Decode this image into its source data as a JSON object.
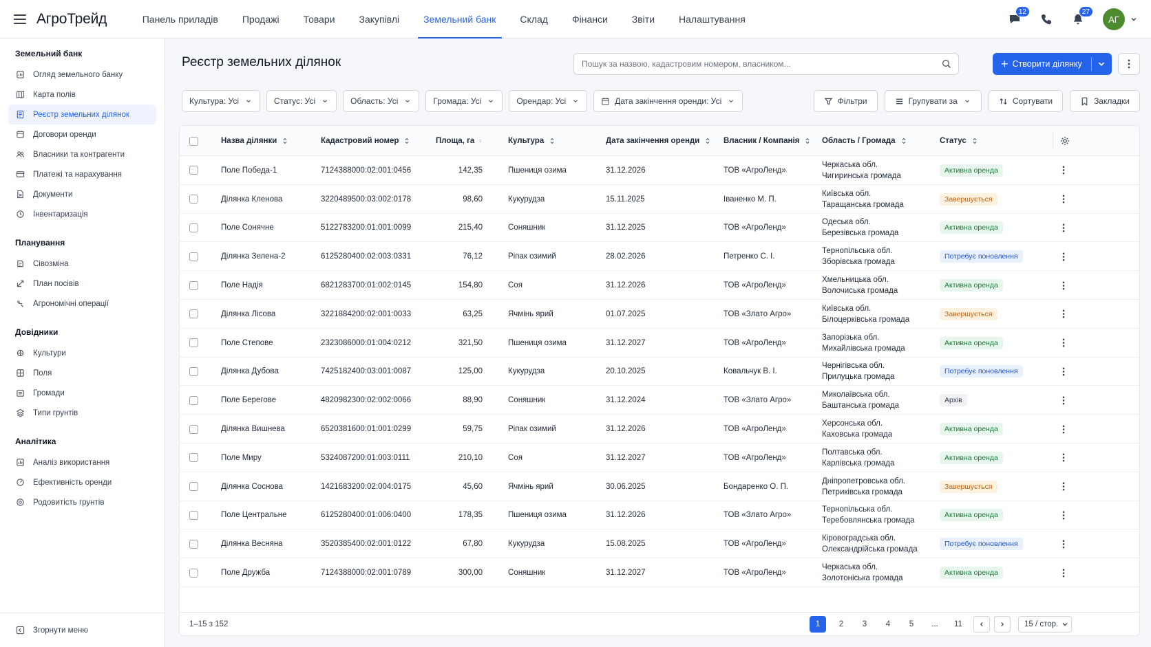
{
  "app": {
    "logo": "АгроТрейд"
  },
  "nav": [
    {
      "label": "Панель приладів",
      "active": false
    },
    {
      "label": "Продажі",
      "active": false
    },
    {
      "label": "Товари",
      "active": false
    },
    {
      "label": "Закупівлі",
      "active": false
    },
    {
      "label": "Земельний банк",
      "active": true
    },
    {
      "label": "Склад",
      "active": false
    },
    {
      "label": "Фінанси",
      "active": false
    },
    {
      "label": "Звіти",
      "active": false
    },
    {
      "label": "Налаштування",
      "active": false
    }
  ],
  "topbar": {
    "messages_badge": "12",
    "notifications_badge": "27",
    "avatar_initials": "АГ",
    "icons": [
      "chat-icon",
      "phone-icon",
      "bell-icon",
      "chevron-down-icon"
    ]
  },
  "sidebar": {
    "sections": [
      {
        "title": "Земельний банк",
        "items": [
          {
            "label": "Огляд земельного банку",
            "icon": "overview-icon",
            "active": false
          },
          {
            "label": "Карта полів",
            "icon": "map-icon",
            "active": false
          },
          {
            "label": "Реєстр земельних ділянок",
            "icon": "register-icon",
            "active": true
          },
          {
            "label": "Договори оренди",
            "icon": "contract-icon",
            "active": false
          },
          {
            "label": "Власники та контрагенти",
            "icon": "users-icon",
            "active": false
          },
          {
            "label": "Платежі та нарахування",
            "icon": "payments-icon",
            "active": false
          },
          {
            "label": "Документи",
            "icon": "document-icon",
            "active": false
          },
          {
            "label": "Інвентаризація",
            "icon": "inventory-icon",
            "active": false
          }
        ]
      },
      {
        "title": "Планування",
        "items": [
          {
            "label": "Сівозміна",
            "icon": "rotation-icon",
            "active": false
          },
          {
            "label": "План посівів",
            "icon": "plan-icon",
            "active": false
          },
          {
            "label": "Агрономічні операції",
            "icon": "tractor-icon",
            "active": false
          }
        ]
      },
      {
        "title": "Довідники",
        "items": [
          {
            "label": "Культури",
            "icon": "crop-icon",
            "active": false
          },
          {
            "label": "Поля",
            "icon": "field-icon",
            "active": false
          },
          {
            "label": "Громади",
            "icon": "community-icon",
            "active": false
          },
          {
            "label": "Типи грунтів",
            "icon": "soil-icon",
            "active": false
          }
        ]
      },
      {
        "title": "Аналітика",
        "items": [
          {
            "label": "Аналіз використання",
            "icon": "analytics-icon",
            "active": false
          },
          {
            "label": "Ефективність оренди",
            "icon": "efficiency-icon",
            "active": false
          },
          {
            "label": "Родовитість грунтів",
            "icon": "fertility-icon",
            "active": false
          }
        ]
      }
    ],
    "collapse_label": "Згорнути меню"
  },
  "page": {
    "title": "Реєстр земельних ділянок",
    "search_placeholder": "Пошук за назвою, кадастровим номером, власником...",
    "create_label": "Створити ділянку"
  },
  "filters": [
    "Культура: Усі",
    "Статус: Усі",
    "Область: Усі",
    "Громада: Усі",
    "Орендар: Усі",
    "Дата закінчення оренди: Усі"
  ],
  "actions": [
    {
      "label": "Фільтри",
      "icon": "filter-icon"
    },
    {
      "label": "Групувати за",
      "icon": "group-icon",
      "dropdown": true
    },
    {
      "label": "Сортувати",
      "icon": "sort-icon"
    },
    {
      "label": "Закладки",
      "icon": "bookmark-icon"
    }
  ],
  "table": {
    "columns": [
      "Назва ділянки",
      "Кадастровий номер",
      "Площа, га",
      "Культура",
      "Дата закінчення оренди",
      "Власник / Компанія",
      "Область / Громада",
      "Статус"
    ],
    "rows": [
      {
        "name": "Поле Победа-1",
        "cadastral": "7124388000:02:001:0456",
        "area": "142,35",
        "crop": "Пшениця озима",
        "date": "31.12.2026",
        "owner": "ТОВ «АгроЛенд»",
        "oblast": "Черкаська обл.",
        "hromada": "Чигиринська громада",
        "status": "Активна оренда",
        "status_type": "active"
      },
      {
        "name": "Ділянка Кленова",
        "cadastral": "3220489500:03:002:0178",
        "area": "98,60",
        "crop": "Кукурудза",
        "date": "15.11.2025",
        "owner": "Іваненко М. П.",
        "oblast": "Київська обл.",
        "hromada": "Таращанська громада",
        "status": "Завершується",
        "status_type": "ending"
      },
      {
        "name": "Поле Сонячне",
        "cadastral": "5122783200:01:001:0099",
        "area": "215,40",
        "crop": "Соняшник",
        "date": "31.12.2025",
        "owner": "ТОВ «АгроЛенд»",
        "oblast": "Одеська обл.",
        "hromada": "Березівська громада",
        "status": "Активна оренда",
        "status_type": "active"
      },
      {
        "name": "Ділянка Зелена-2",
        "cadastral": "6125280400:02:003:0331",
        "area": "76,12",
        "crop": "Ріпак озимий",
        "date": "28.02.2026",
        "owner": "Петренко С. І.",
        "oblast": "Тернопільська обл.",
        "hromada": "Зборівська громада",
        "status": "Потребує поновлення",
        "status_type": "renew"
      },
      {
        "name": "Поле Надія",
        "cadastral": "6821283700:01:002:0145",
        "area": "154,80",
        "crop": "Соя",
        "date": "31.12.2026",
        "owner": "ТОВ «АгроЛенд»",
        "oblast": "Хмельницька обл.",
        "hromada": "Волочиська громада",
        "status": "Активна оренда",
        "status_type": "active"
      },
      {
        "name": "Ділянка Лісова",
        "cadastral": "3221884200:02:001:0033",
        "area": "63,25",
        "crop": "Ячмінь ярий",
        "date": "01.07.2025",
        "owner": "ТОВ «Злато Агро»",
        "oblast": "Київська обл.",
        "hromada": "Білоцерківська громада",
        "status": "Завершується",
        "status_type": "ending"
      },
      {
        "name": "Поле Степове",
        "cadastral": "2323086000:01:004:0212",
        "area": "321,50",
        "crop": "Пшениця озима",
        "date": "31.12.2027",
        "owner": "ТОВ «АгроЛенд»",
        "oblast": "Запорізька обл.",
        "hromada": "Михайлівська громада",
        "status": "Активна оренда",
        "status_type": "active"
      },
      {
        "name": "Ділянка Дубова",
        "cadastral": "7425182400:03:001:0087",
        "area": "125,00",
        "crop": "Кукурудза",
        "date": "20.10.2025",
        "owner": "Ковальчук В. І.",
        "oblast": "Чернігівська обл.",
        "hromada": "Прилуцька громада",
        "status": "Потребує поновлення",
        "status_type": "renew"
      },
      {
        "name": "Поле Берегове",
        "cadastral": "4820982300:02:002:0066",
        "area": "88,90",
        "crop": "Соняшник",
        "date": "31.12.2024",
        "owner": "ТОВ «Злато Агро»",
        "oblast": "Миколаївська обл.",
        "hromada": "Баштанська громада",
        "status": "Архів",
        "status_type": "archive"
      },
      {
        "name": "Ділянка Вишнева",
        "cadastral": "6520381600:01:001:0299",
        "area": "59,75",
        "crop": "Ріпак озимий",
        "date": "31.12.2026",
        "owner": "ТОВ «АгроЛенд»",
        "oblast": "Херсонська обл.",
        "hromada": "Каховська громада",
        "status": "Активна оренда",
        "status_type": "active"
      },
      {
        "name": "Поле Миру",
        "cadastral": "5324087200:01:003:0111",
        "area": "210,10",
        "crop": "Соя",
        "date": "31.12.2027",
        "owner": "ТОВ «АгроЛенд»",
        "oblast": "Полтавська обл.",
        "hromada": "Карлівська громада",
        "status": "Активна оренда",
        "status_type": "active"
      },
      {
        "name": "Ділянка Соснова",
        "cadastral": "1421683200:02:004:0175",
        "area": "45,60",
        "crop": "Ячмінь ярий",
        "date": "30.06.2025",
        "owner": "Бондаренко О. П.",
        "oblast": "Дніпропетровська обл.",
        "hromada": "Петриківська громада",
        "status": "Завершується",
        "status_type": "ending"
      },
      {
        "name": "Поле Центральне",
        "cadastral": "6125280400:01:006:0400",
        "area": "178,35",
        "crop": "Пшениця озима",
        "date": "31.12.2026",
        "owner": "ТОВ «Злато Агро»",
        "oblast": "Тернопільська обл.",
        "hromada": "Теребовлянська громада",
        "status": "Активна оренда",
        "status_type": "active"
      },
      {
        "name": "Ділянка Весняна",
        "cadastral": "3520385400:02:001:0122",
        "area": "67,80",
        "crop": "Кукурудза",
        "date": "15.08.2025",
        "owner": "ТОВ «АгроЛенд»",
        "oblast": "Кіровоградська обл.",
        "hromada": "Олександрійська громада",
        "status": "Потребує поновлення",
        "status_type": "renew"
      },
      {
        "name": "Поле Дружба",
        "cadastral": "7124388000:02:001:0789",
        "area": "300,00",
        "crop": "Соняшник",
        "date": "31.12.2027",
        "owner": "ТОВ «АгроЛенд»",
        "oblast": "Черкаська обл.",
        "hromada": "Золотоніська громада",
        "status": "Активна оренда",
        "status_type": "active"
      }
    ]
  },
  "pagination": {
    "range": "1–15 з 152",
    "pages": [
      "1",
      "2",
      "3",
      "4",
      "5",
      "...",
      "11"
    ],
    "current": "1",
    "per_page": "15 / стор."
  },
  "colors": {
    "accent": "#2563eb",
    "avatar": "#4d8b31"
  }
}
